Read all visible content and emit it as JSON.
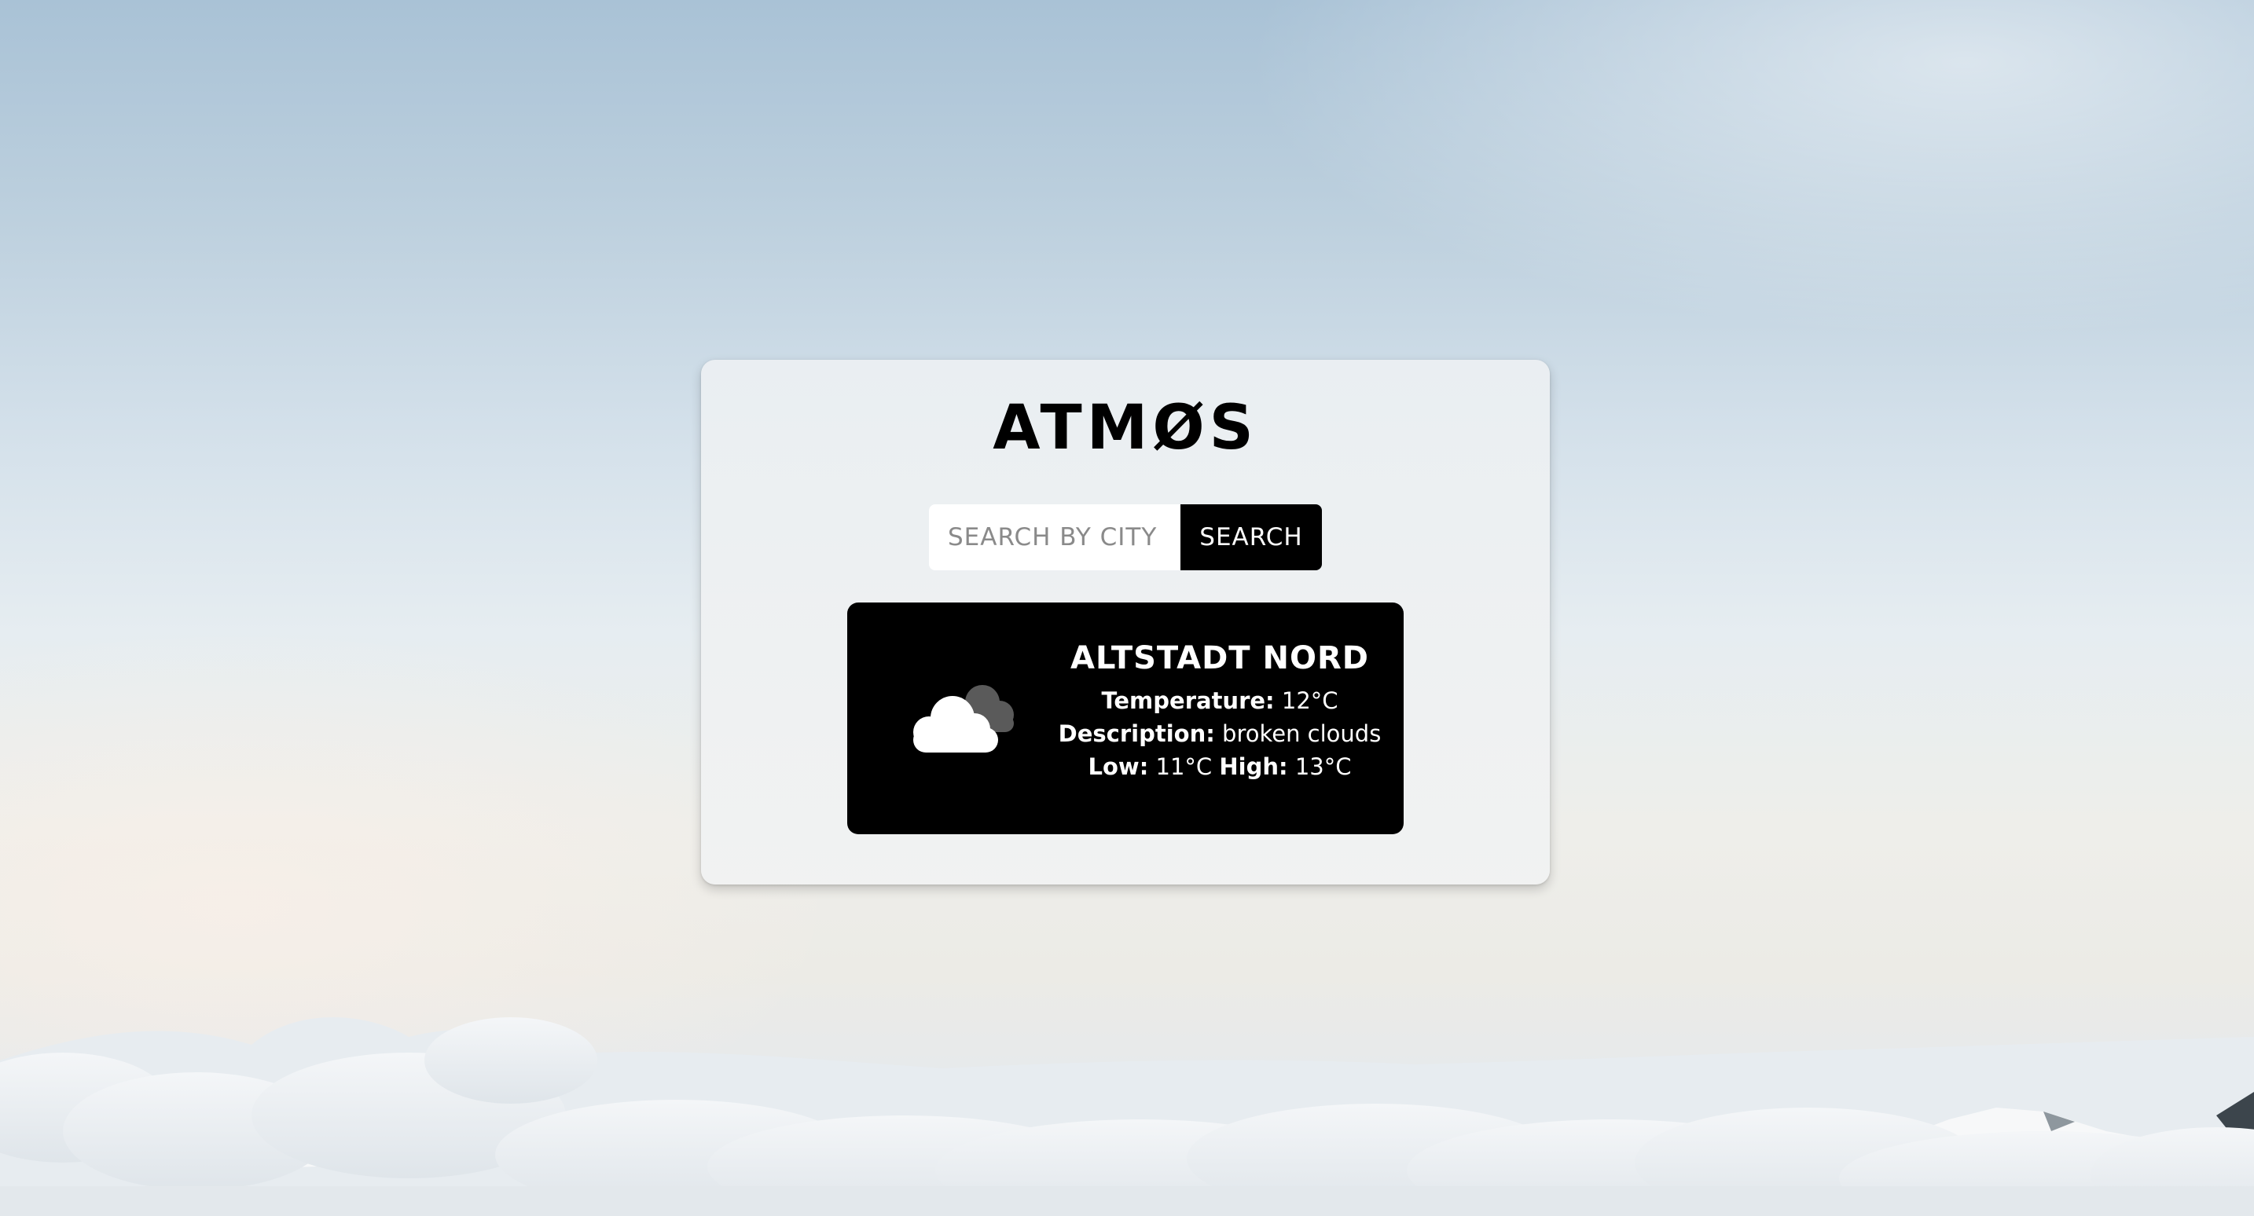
{
  "app": {
    "title": "ATMØS"
  },
  "search": {
    "placeholder": "SEARCH BY CITY",
    "value": "",
    "button_label": "SEARCH"
  },
  "weather": {
    "icon": "broken-clouds-icon",
    "city": "ALTSTADT NORD",
    "temperature_label": "Temperature:",
    "temperature_value": "12°C",
    "description_label": "Description:",
    "description_value": "broken clouds",
    "low_label": "Low:",
    "low_value": "11°C",
    "high_label": "High:",
    "high_value": "13°C"
  },
  "colors": {
    "card_background": "#eef1f3",
    "result_background": "#000000",
    "button_background": "#000000",
    "text_primary": "#000000",
    "text_on_dark": "#ffffff"
  }
}
